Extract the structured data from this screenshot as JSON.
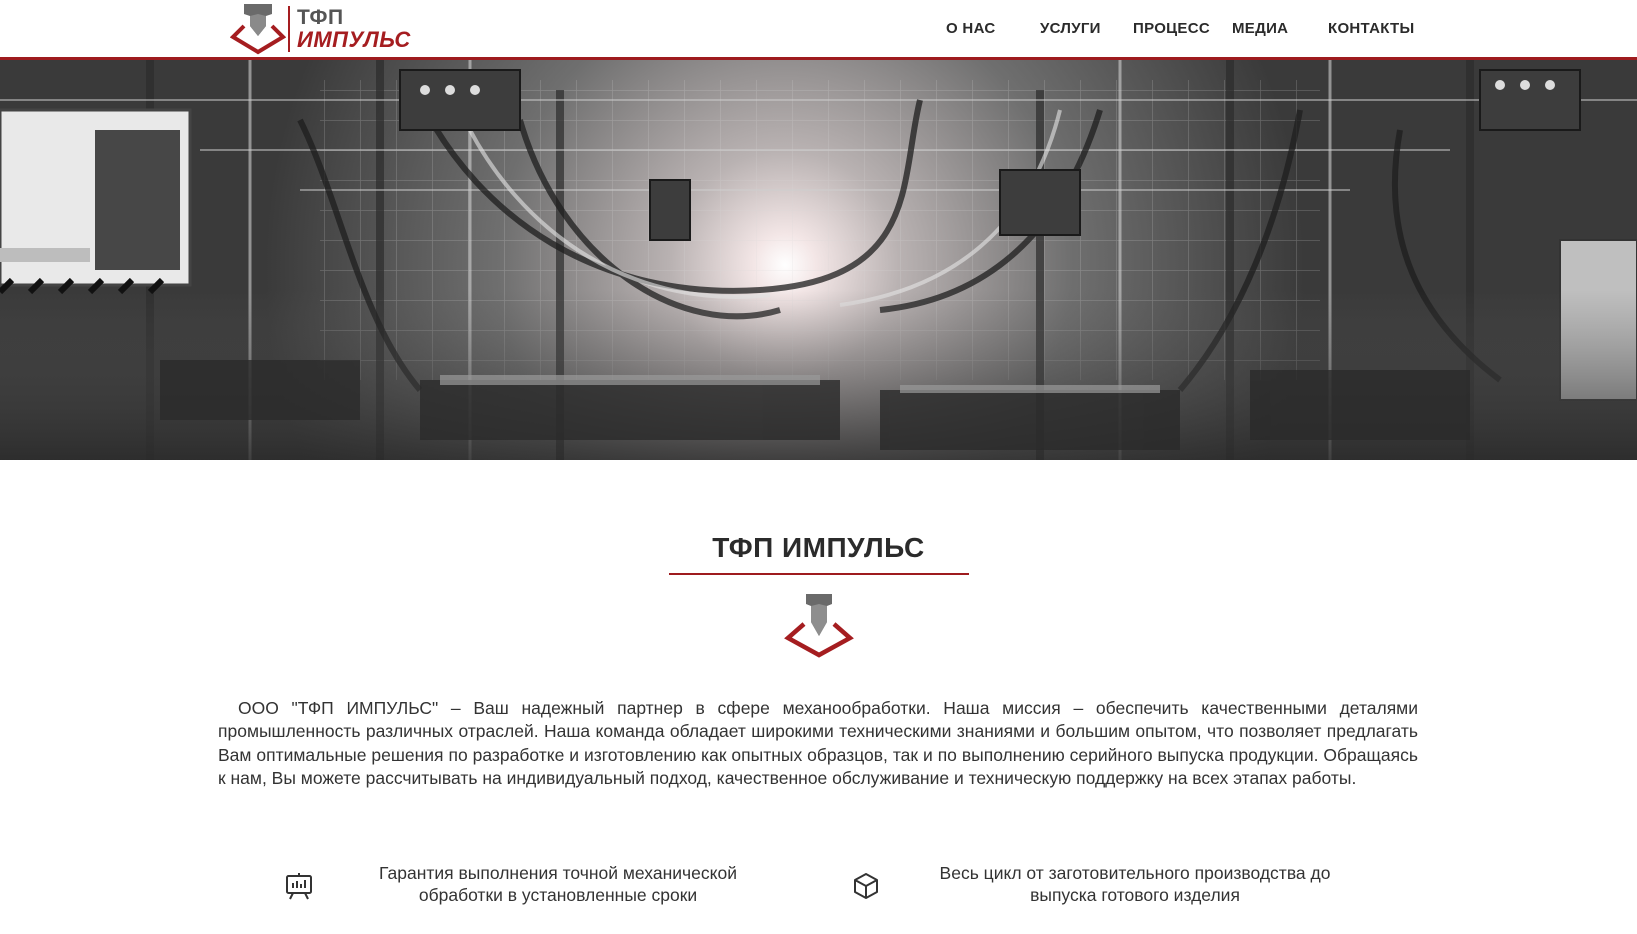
{
  "header": {
    "logo": {
      "line1": "ТФП",
      "line2": "ИМПУЛЬС"
    },
    "nav": [
      {
        "label": "О НАС"
      },
      {
        "label": "УСЛУГИ"
      },
      {
        "label": "ПРОЦЕСС"
      },
      {
        "label": "МЕДИА"
      },
      {
        "label": "КОНТАКТЫ"
      }
    ]
  },
  "hero": {
    "image": "factory-machinery-photo"
  },
  "main": {
    "title": "ТФП ИМПУЛЬС",
    "about": "ООО \"ТФП ИМПУЛЬС\" – Ваш надежный партнер в сфере механообработки. Наша миссия – обеспечить качественными деталями промышленность различных отраслей. Наша команда обладает широкими техническими знаниями и большим опытом, что позволяет предлагать Вам оптимальные решения по разработке и изготовлению как опытных образцов, так и по выполнению серийного выпуска продукции. Обращаясь к нам, Вы можете рассчитывать на индивидуальный подход, качественное обслуживание и техническую поддержку на всех этапах работы.",
    "features": [
      {
        "icon": "presentation-chart-icon",
        "text": "Гарантия выполнения точной механической обработки в установленные сроки"
      },
      {
        "icon": "box-cube-icon",
        "text": "Весь цикл от заготовительного производства до выпуска готового изделия"
      }
    ]
  },
  "colors": {
    "accent": "#9e1b1e",
    "text": "#2b2b2b",
    "logo_gray": "#555555"
  }
}
